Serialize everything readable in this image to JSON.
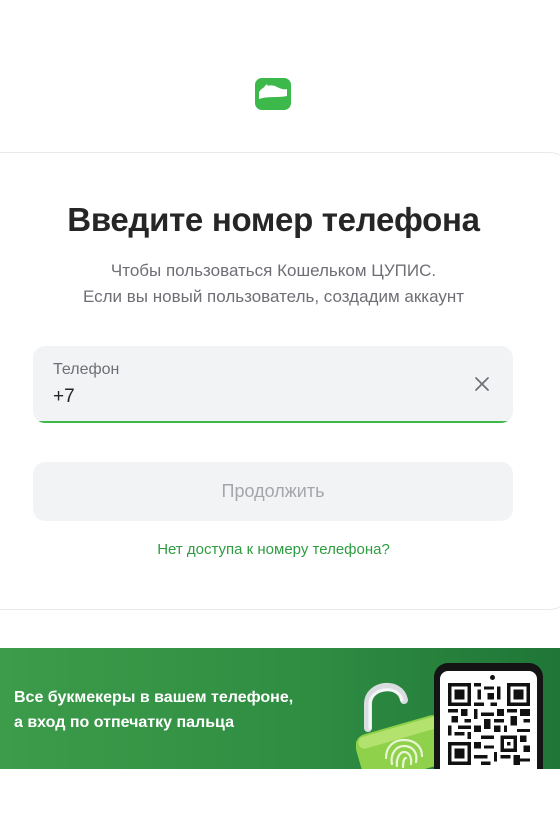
{
  "header": {
    "logo_icon": "wallet-logo-icon",
    "brand_color": "#3cb94a"
  },
  "form": {
    "title": "Введите номер телефона",
    "subtitle_line1": "Чтобы пользоваться Кошельком ЦУПИС.",
    "subtitle_line2": "Если вы новый пользователь, создадим аккаунт",
    "phone_label": "Телефон",
    "phone_value": "+7",
    "clear_icon": "close-icon",
    "continue_label": "Продолжить",
    "no_access_link": "Нет доступа к номеру телефона?"
  },
  "banner": {
    "line1": "Все букмекеры в вашем телефоне,",
    "line2": "а вход по отпечатку пальца",
    "lock_icon": "fingerprint-padlock-icon",
    "qr_icon": "qr-code-icon"
  }
}
